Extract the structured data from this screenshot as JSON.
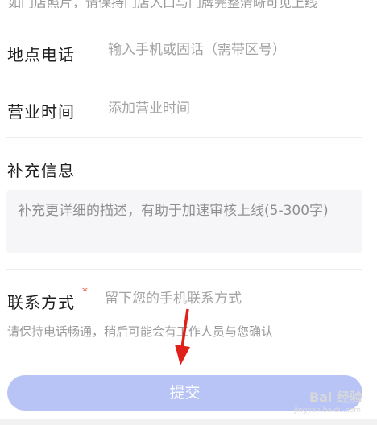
{
  "form": {
    "top_partial_text": "如门店照片，请保持门店入口与门牌完整清晰可见上线",
    "phone": {
      "label": "地点电话",
      "placeholder": "输入手机或固话（需带区号）"
    },
    "hours": {
      "label": "营业时间",
      "placeholder": "添加营业时间"
    },
    "extra": {
      "label": "补充信息",
      "placeholder": "补充更详细的描述，有助于加速审核上线(5-300字)"
    },
    "contact": {
      "label": "联系方式",
      "required_mark": "*",
      "placeholder": "留下您的手机联系方式",
      "hint": "请保持电话畅通，稍后可能会有工作人员与您确认"
    },
    "submit_label": "提交"
  },
  "watermark": {
    "text": "Bai 经验",
    "sub": "jingyan.baidu.com"
  },
  "colors": {
    "submit_bg": "#b9c4f6",
    "required": "#e74c3c",
    "annotation_arrow": "#e0201b"
  }
}
